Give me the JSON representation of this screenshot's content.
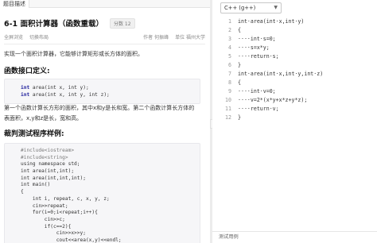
{
  "tabs": {
    "description": "题目描述"
  },
  "problem": {
    "title": "6-1 面积计算器（函数重载）",
    "score": "分数 12",
    "actions": [
      "全屏浏览",
      "切换布局"
    ],
    "author": "作者 何振峰",
    "org": "单位 福州大学",
    "intro": "实现一个面积计算器，它能够计算矩形或长方体的面积。",
    "h_interface": "函数接口定义:",
    "interface_code": [
      "int area(int x, int y);",
      "int area(int x, int y, int z);"
    ],
    "explain_line1": "第一个函数计算长方形的面积，其中x和y是长和宽。第二个函数计算长方体的",
    "explain_line2": "表面积，x,y和z是长，宽和高。",
    "h_sample": "裁判测试程序样例:",
    "sample_code": [
      "#include<iostream>",
      "#include<string>",
      "using namespace std;",
      "int area(int,int);",
      "int area(int,int,int);",
      "int main()",
      "{",
      "    int i, repeat, c, x, y, z;",
      "    cin>>repeat;",
      "    for(i=0;i<repeat;i++){",
      "        cin>>c;",
      "        if(c==2){",
      "            cin>>x>>y;",
      "            cout<<area(x,y)<<endl;",
      "        }"
    ]
  },
  "editor": {
    "language": "C++ (g++)",
    "line_numbers": [
      "1",
      "2",
      "3",
      "4",
      "5",
      "6",
      "7",
      "8",
      "9",
      "10",
      "11",
      "12"
    ],
    "lines": [
      "int·area(int·x,int·y)",
      "{",
      "····int·s=0;",
      "····s=x*y;",
      "····return·s;",
      "}",
      "int·area(int·x,int·y,int·z)",
      "{",
      "····int·v=0;",
      "····v=2*(x*y+x*z+y*z);",
      "····return·v;",
      "}"
    ]
  },
  "bottom": {
    "test_tab": "测试用例"
  }
}
